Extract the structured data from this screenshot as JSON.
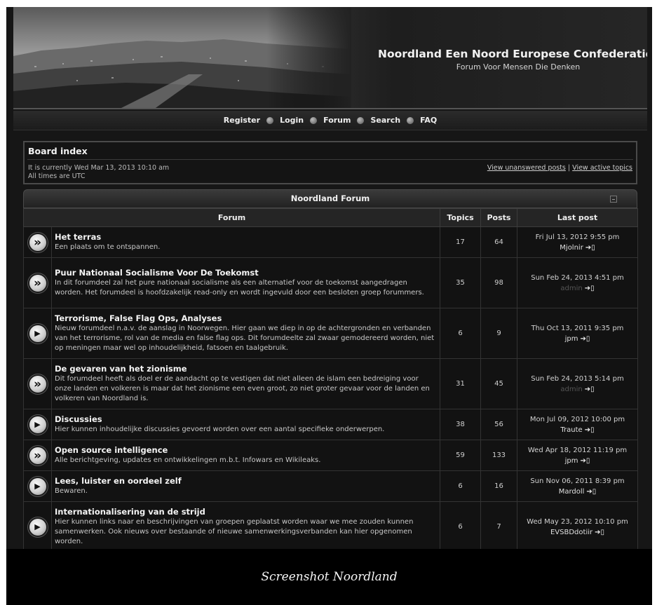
{
  "header": {
    "site_title": "Noordland Een Noord Europese Confederatie",
    "tagline": "Forum Voor Mensen Die Denken"
  },
  "nav": {
    "items": [
      {
        "label": "Register"
      },
      {
        "label": "Login"
      },
      {
        "label": "Forum"
      },
      {
        "label": "Search"
      },
      {
        "label": "FAQ"
      }
    ]
  },
  "board": {
    "title": "Board index",
    "current_time": "It is currently Wed Mar 13, 2013 10:10 am",
    "timezone": "All times are UTC",
    "link_unanswered": "View unanswered posts",
    "separator": "|",
    "link_active": "View active topics"
  },
  "forum": {
    "caption": "Noordland Forum",
    "columns": {
      "forum": "Forum",
      "topics": "Topics",
      "posts": "Posts",
      "last_post": "Last post"
    },
    "rows": [
      {
        "name": "Het terras",
        "desc": "Een plaats om te ontspannen.",
        "topics": "17",
        "posts": "64",
        "last_date": "Fri Jul 13, 2012 9:55 pm",
        "last_author": "Mjolnir",
        "icon": "double"
      },
      {
        "name": "Puur Nationaal Socialisme Voor De Toekomst",
        "desc": "In dit forumdeel zal het pure nationaal socialisme als een alternatief voor de toekomst aangedragen worden. Het forumdeel is hoofdzakelijk read-only en wordt ingevuld door een besloten groep forummers.",
        "topics": "35",
        "posts": "98",
        "last_date": "Sun Feb 24, 2013 4:51 pm",
        "last_author": "admin",
        "icon": "double"
      },
      {
        "name": "Terrorisme, False Flag Ops, Analyses",
        "desc": "Nieuw forumdeel n.a.v. de aanslag in Noorwegen. Hier gaan we diep in op de achtergronden en verbanden van het terrorisme, rol van de media en false flag ops. Dit forumdeelte zal zwaar gemodereerd worden, niet op meningen maar wel op inhoudelijkheid, fatsoen en taalgebruik.",
        "topics": "6",
        "posts": "9",
        "last_date": "Thu Oct 13, 2011 9:35 pm",
        "last_author": "jpm",
        "icon": "single"
      },
      {
        "name": "De gevaren van het zionisme",
        "desc": "Dit forumdeel heeft als doel er de aandacht op te vestigen dat niet alleen de islam een bedreiging voor onze landen en volkeren is maar dat het zionisme een even groot, zo niet groter gevaar voor de landen en volkeren van Noordland is.",
        "topics": "31",
        "posts": "45",
        "last_date": "Sun Feb 24, 2013 5:14 pm",
        "last_author": "admin",
        "icon": "double"
      },
      {
        "name": "Discussies",
        "desc": "Hier kunnen inhoudelijke discussies gevoerd worden over een aantal specifieke onderwerpen.",
        "topics": "38",
        "posts": "56",
        "last_date": "Mon Jul 09, 2012 10:00 pm",
        "last_author": "Traute",
        "icon": "single"
      },
      {
        "name": "Open source intelligence",
        "desc": "Alle berichtgeving, updates en ontwikkelingen m.b.t. Infowars en Wikileaks.",
        "topics": "59",
        "posts": "133",
        "last_date": "Wed Apr 18, 2012 11:19 pm",
        "last_author": "jpm",
        "icon": "double"
      },
      {
        "name": "Lees, luister en oordeel zelf",
        "desc": "Bewaren.",
        "topics": "6",
        "posts": "16",
        "last_date": "Sun Nov 06, 2011 8:39 pm",
        "last_author": "Mardoll",
        "icon": "single"
      },
      {
        "name": "Internationalisering van de strijd",
        "desc": "Hier kunnen links naar en beschrijvingen van groepen geplaatst worden waar we mee zouden kunnen samenwerken. Ook nieuws over bestaande of nieuwe samenwerkingsverbanden kan hier opgenomen worden.",
        "topics": "6",
        "posts": "7",
        "last_date": "Wed May 23, 2012 10:10 pm",
        "last_author": "EVSBDdotiir",
        "icon": "single"
      }
    ]
  },
  "caption": "Screenshot Noordland"
}
